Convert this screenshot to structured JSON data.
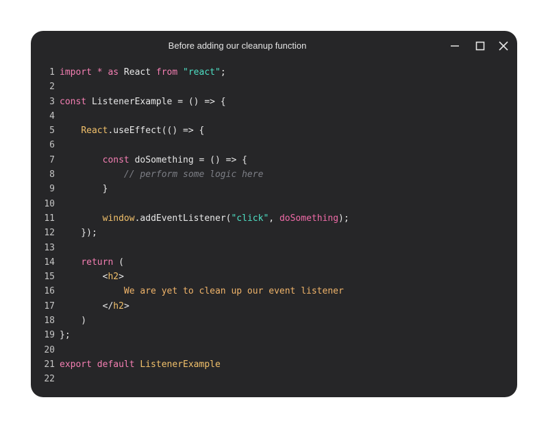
{
  "window": {
    "title": "Before adding our cleanup function"
  },
  "controls": [
    "minimize-icon",
    "maximize-icon",
    "close-icon"
  ],
  "colors": {
    "background": "#262628",
    "keyword": "#f57fb3",
    "string": "#4ee0c5",
    "function": "#f2c16b",
    "comment": "#7d7f86"
  },
  "code": {
    "lines": [
      {
        "n": "1",
        "tokens": [
          [
            "kw",
            "import * as "
          ],
          [
            "pl",
            "React "
          ],
          [
            "kw",
            "from "
          ],
          [
            "str",
            "\"react\""
          ],
          [
            "pl",
            ";"
          ]
        ]
      },
      {
        "n": "2",
        "tokens": []
      },
      {
        "n": "3",
        "tokens": [
          [
            "kw",
            "const "
          ],
          [
            "pl",
            "ListenerExample = () => {"
          ]
        ]
      },
      {
        "n": "4",
        "tokens": []
      },
      {
        "n": "5",
        "tokens": [
          [
            "pl",
            "    "
          ],
          [
            "fn",
            "React"
          ],
          [
            "pl",
            ".useEffect(() => {"
          ]
        ]
      },
      {
        "n": "6",
        "tokens": []
      },
      {
        "n": "7",
        "tokens": [
          [
            "pl",
            "        "
          ],
          [
            "kw",
            "const "
          ],
          [
            "pl",
            "doSomething = () => {"
          ]
        ]
      },
      {
        "n": "8",
        "tokens": [
          [
            "pl",
            "            "
          ],
          [
            "cm",
            "// perform some logic here"
          ]
        ]
      },
      {
        "n": "9",
        "tokens": [
          [
            "pl",
            "        }"
          ]
        ]
      },
      {
        "n": "10",
        "tokens": []
      },
      {
        "n": "11",
        "tokens": [
          [
            "pl",
            "        "
          ],
          [
            "fn",
            "window"
          ],
          [
            "pl",
            ".addEventListener("
          ],
          [
            "str",
            "\"click\""
          ],
          [
            "pl",
            ", "
          ],
          [
            "var",
            "doSomething"
          ],
          [
            "pl",
            ");"
          ]
        ]
      },
      {
        "n": "12",
        "tokens": [
          [
            "pl",
            "    });"
          ]
        ]
      },
      {
        "n": "13",
        "tokens": []
      },
      {
        "n": "14",
        "tokens": [
          [
            "pl",
            "    "
          ],
          [
            "kw",
            "return "
          ],
          [
            "pl",
            "("
          ]
        ]
      },
      {
        "n": "15",
        "tokens": [
          [
            "pl",
            "        <"
          ],
          [
            "tag",
            "h2"
          ],
          [
            "pl",
            ">"
          ]
        ]
      },
      {
        "n": "16",
        "tokens": [
          [
            "pl",
            "            "
          ],
          [
            "txt",
            "We are yet to clean up our event listener"
          ]
        ]
      },
      {
        "n": "17",
        "tokens": [
          [
            "pl",
            "        </"
          ],
          [
            "tag",
            "h2"
          ],
          [
            "pl",
            ">"
          ]
        ]
      },
      {
        "n": "18",
        "tokens": [
          [
            "pl",
            "    )"
          ]
        ]
      },
      {
        "n": "19",
        "tokens": [
          [
            "pl",
            "};"
          ]
        ]
      },
      {
        "n": "20",
        "tokens": []
      },
      {
        "n": "21",
        "tokens": [
          [
            "kw",
            "export default "
          ],
          [
            "fn",
            "ListenerExample"
          ]
        ]
      },
      {
        "n": "22",
        "tokens": []
      }
    ]
  }
}
